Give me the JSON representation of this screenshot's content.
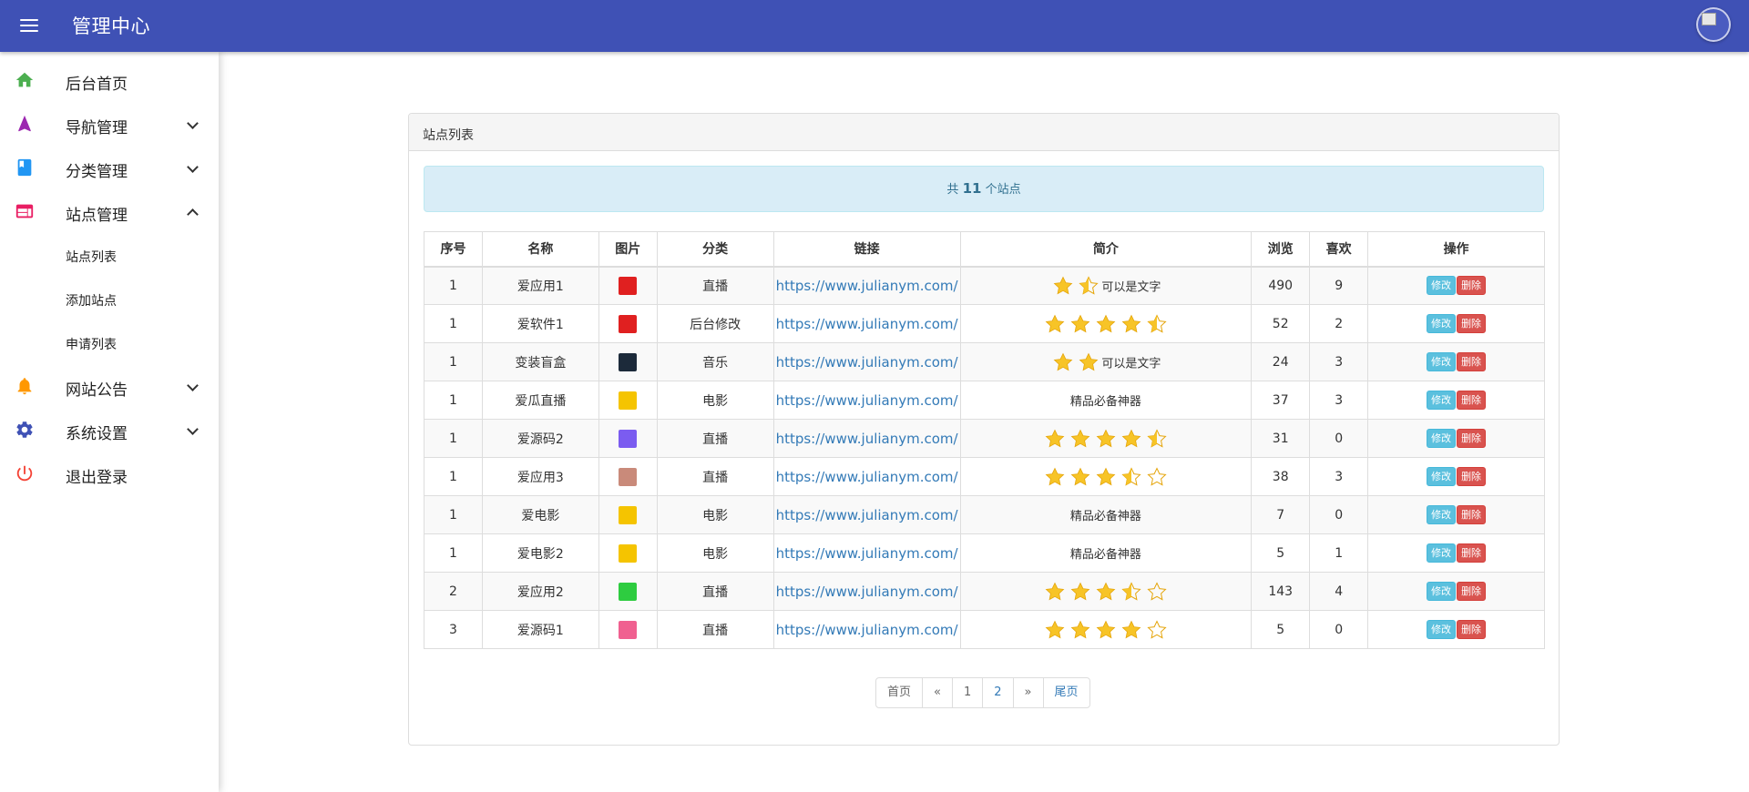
{
  "header": {
    "title": "管理中心",
    "menu_icon": "hamburger-icon",
    "avatar_icon": "broken-image-icon"
  },
  "sidebar": {
    "items": [
      {
        "label": "后台首页",
        "icon": "home-icon",
        "color": "#4caf50"
      },
      {
        "label": "导航管理",
        "icon": "navigation-arrow-icon",
        "color": "#9c27b0"
      },
      {
        "label": "分类管理",
        "icon": "book-icon",
        "color": "#2196f3"
      },
      {
        "label": "站点管理",
        "icon": "web-icon",
        "color": "#e91e63"
      },
      {
        "label": "网站公告",
        "icon": "bell-icon",
        "color": "#ff9800"
      },
      {
        "label": "系统设置",
        "icon": "gear-icon",
        "color": "#3f51b5"
      },
      {
        "label": "退出登录",
        "icon": "power-icon",
        "color": "#f44336"
      }
    ],
    "sub_items": [
      {
        "label": "站点列表"
      },
      {
        "label": "添加站点"
      },
      {
        "label": "申请列表"
      }
    ]
  },
  "panel": {
    "title": "站点列表",
    "info": {
      "prefix": "共",
      "count": "11",
      "suffix": "个站点"
    }
  },
  "table": {
    "headers": [
      "序号",
      "名称",
      "图片",
      "分类",
      "链接",
      "简介",
      "浏览",
      "喜欢",
      "操作"
    ],
    "rows": [
      {
        "no": "1",
        "name": "爱应用1",
        "img": "#e02020",
        "category": "直播",
        "link": "https://www.julianym.com/",
        "stars": 1.5,
        "text": "可以是文字",
        "views": "490",
        "likes": "9"
      },
      {
        "no": "1",
        "name": "爱软件1",
        "img": "#e02020",
        "category": "后台修改",
        "link": "https://www.julianym.com/",
        "stars": 4.5,
        "text": "",
        "views": "52",
        "likes": "2"
      },
      {
        "no": "1",
        "name": "变装盲盒",
        "img": "#1c2a3a",
        "category": "音乐",
        "link": "https://www.julianym.com/",
        "stars": 2,
        "text": "可以是文字",
        "views": "24",
        "likes": "3"
      },
      {
        "no": "1",
        "name": "爱瓜直播",
        "img": "#f5c400",
        "category": "电影",
        "link": "https://www.julianym.com/",
        "stars": 0,
        "text": "精品必备神器",
        "views": "37",
        "likes": "3"
      },
      {
        "no": "1",
        "name": "爱源码2",
        "img": "#7b5cf0",
        "category": "直播",
        "link": "https://www.julianym.com/",
        "stars": 4.5,
        "text": "",
        "views": "31",
        "likes": "0"
      },
      {
        "no": "1",
        "name": "爱应用3",
        "img": "#c98a7a",
        "category": "直播",
        "link": "https://www.julianym.com/",
        "stars": 3.5,
        "stars_total": 5,
        "text": "",
        "views": "38",
        "likes": "3"
      },
      {
        "no": "1",
        "name": "爱电影",
        "img": "#f5c400",
        "category": "电影",
        "link": "https://www.julianym.com/",
        "stars": 0,
        "text": "精品必备神器",
        "views": "7",
        "likes": "0"
      },
      {
        "no": "1",
        "name": "爱电影2",
        "img": "#f5c400",
        "category": "电影",
        "link": "https://www.julianym.com/",
        "stars": 0,
        "text": "精品必备神器",
        "views": "5",
        "likes": "1"
      },
      {
        "no": "2",
        "name": "爱应用2",
        "img": "#2ecc40",
        "category": "直播",
        "link": "https://www.julianym.com/",
        "stars": 3.5,
        "stars_total": 5,
        "text": "",
        "views": "143",
        "likes": "4"
      },
      {
        "no": "3",
        "name": "爱源码1",
        "img": "#f06090",
        "category": "直播",
        "link": "https://www.julianym.com/",
        "stars": 4,
        "stars_total": 5,
        "text": "",
        "views": "5",
        "likes": "0"
      }
    ],
    "edit_label": "修改",
    "delete_label": "删除"
  },
  "pagination": {
    "first": "首页",
    "prev": "«",
    "pages": [
      "1",
      "2"
    ],
    "next": "»",
    "last": "尾页"
  }
}
